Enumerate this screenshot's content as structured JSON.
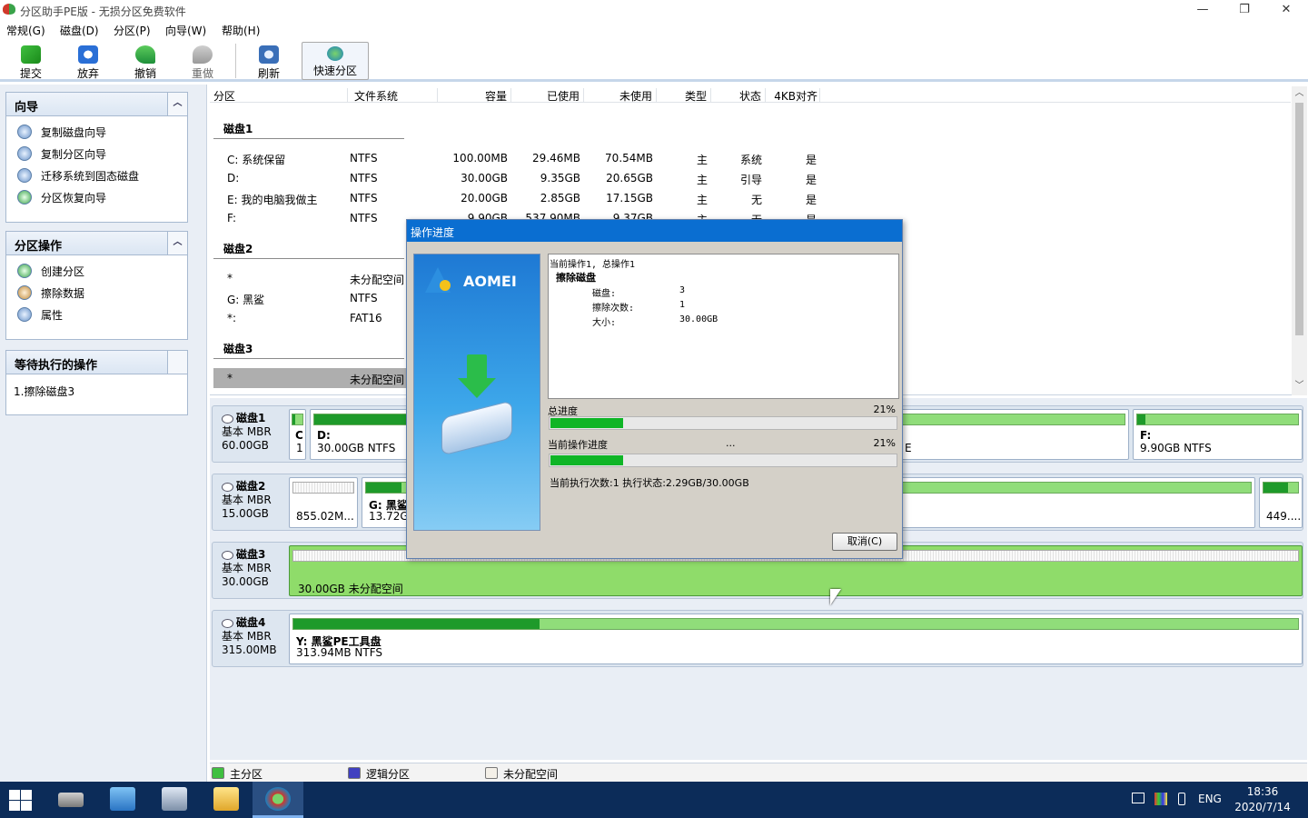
{
  "window": {
    "title": "分区助手PE版 - 无损分区免费软件",
    "minimize": "—",
    "restore": "❐",
    "close": "✕"
  },
  "menu": [
    "常规(G)",
    "磁盘(D)",
    "分区(P)",
    "向导(W)",
    "帮助(H)"
  ],
  "toolbar": {
    "commit": "提交",
    "discard": "放弃",
    "undo": "撤销",
    "redo": "重做",
    "refresh": "刷新",
    "quick": "快速分区"
  },
  "wizard_panel": {
    "title": "向导",
    "items": [
      "复制磁盘向导",
      "复制分区向导",
      "迁移系统到固态磁盘",
      "分区恢复向导"
    ]
  },
  "partition_ops": {
    "title": "分区操作",
    "items": [
      "创建分区",
      "擦除数据",
      "属性"
    ]
  },
  "pending": {
    "title": "等待执行的操作",
    "items": [
      "1.擦除磁盘3"
    ]
  },
  "columns": [
    "分区",
    "文件系统",
    "容量",
    "已使用",
    "未使用",
    "类型",
    "状态",
    "4KB对齐"
  ],
  "disks_list": [
    {
      "name": "磁盘1",
      "rows": [
        {
          "part": "C: 系统保留",
          "fs": "NTFS",
          "cap": "100.00MB",
          "used": "29.46MB",
          "free": "70.54MB",
          "type": "主",
          "status": "系统",
          "align": "是"
        },
        {
          "part": "D:",
          "fs": "NTFS",
          "cap": "30.00GB",
          "used": "9.35GB",
          "free": "20.65GB",
          "type": "主",
          "status": "引导",
          "align": "是"
        },
        {
          "part": "E: 我的电脑我做主",
          "fs": "NTFS",
          "cap": "20.00GB",
          "used": "2.85GB",
          "free": "17.15GB",
          "type": "主",
          "status": "无",
          "align": "是"
        },
        {
          "part": "F:",
          "fs": "NTFS",
          "cap": "9.90GB",
          "used": "537.90MB",
          "free": "9.37GB",
          "type": "主",
          "status": "无",
          "align": "是"
        }
      ]
    },
    {
      "name": "磁盘2",
      "rows": [
        {
          "part": "*",
          "fs": "未分配空间"
        },
        {
          "part": "G: 黑鲨",
          "fs": "NTFS"
        },
        {
          "part": "*:",
          "fs": "FAT16"
        }
      ]
    },
    {
      "name": "磁盘3",
      "rows": [
        {
          "part": "*",
          "fs": "未分配空间"
        }
      ]
    }
  ],
  "disk_map": [
    {
      "name": "磁盘1",
      "kind": "基本 MBR",
      "size": "60.00GB",
      "blocks": [
        {
          "t1": "C",
          "t2": "1"
        },
        {
          "t1": "D:",
          "t2": "30.00GB NTFS"
        },
        {
          "t1": "",
          "t2": "E"
        },
        {
          "t1": "F:",
          "t2": "9.90GB NTFS"
        }
      ]
    },
    {
      "name": "磁盘2",
      "kind": "基本 MBR",
      "size": "15.00GB",
      "blocks": [
        {
          "t1": "",
          "t2": "855.02M..."
        },
        {
          "t1": "G: 黑鲨",
          "t2": "13.72G"
        },
        {
          "t1": "",
          "t2": "449...."
        }
      ]
    },
    {
      "name": "磁盘3",
      "kind": "基本 MBR",
      "size": "30.00GB",
      "blocks": [
        {
          "t1": "",
          "t2": "30.00GB 未分配空间"
        }
      ]
    },
    {
      "name": "磁盘4",
      "kind": "基本 MBR",
      "size": "315.00MB",
      "blocks": [
        {
          "t1": "Y: 黑鲨PE工具盘",
          "t2": "313.94MB NTFS"
        }
      ]
    }
  ],
  "legend": [
    "主分区",
    "逻辑分区",
    "未分配空间"
  ],
  "dialog": {
    "title": "操作进度",
    "brand": "AOMEI",
    "op_header": "当前操作1, 总操作1",
    "op_name": "擦除磁盘",
    "fields": [
      {
        "k": "磁盘:",
        "v": "3"
      },
      {
        "k": "擦除次数:",
        "v": "1"
      },
      {
        "k": "大小:",
        "v": "30.00GB"
      }
    ],
    "total_label": "总进度",
    "total_pct": "21%",
    "total_value": 0.21,
    "current_label": "当前操作进度",
    "current_dots": "...",
    "current_pct": "21%",
    "current_value": 0.21,
    "status": "当前执行次数:1  执行状态:2.29GB/30.00GB",
    "cancel": "取消(C)"
  },
  "taskbar": {
    "lang": "ENG",
    "time": "18:36",
    "date": "2020/7/14"
  },
  "colors": {
    "primary": "#90dd7a",
    "used": "#1e9a2a",
    "logical": "#4040c0",
    "dialog_title": "#0a6ed1"
  }
}
